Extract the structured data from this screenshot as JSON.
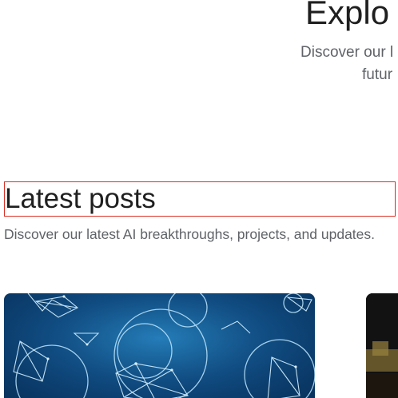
{
  "hero": {
    "title": "Explo",
    "subtitle_line1": "Discover our l",
    "subtitle_line2": "futur"
  },
  "latest": {
    "heading": "Latest posts",
    "description": "Discover our latest AI breakthroughs, projects, and updates."
  },
  "cards": [
    {
      "image_name": "abstract-network-image",
      "accent": "#0f4a80"
    },
    {
      "image_name": "partial-photo-image",
      "accent": "#6e5a2a"
    }
  ]
}
